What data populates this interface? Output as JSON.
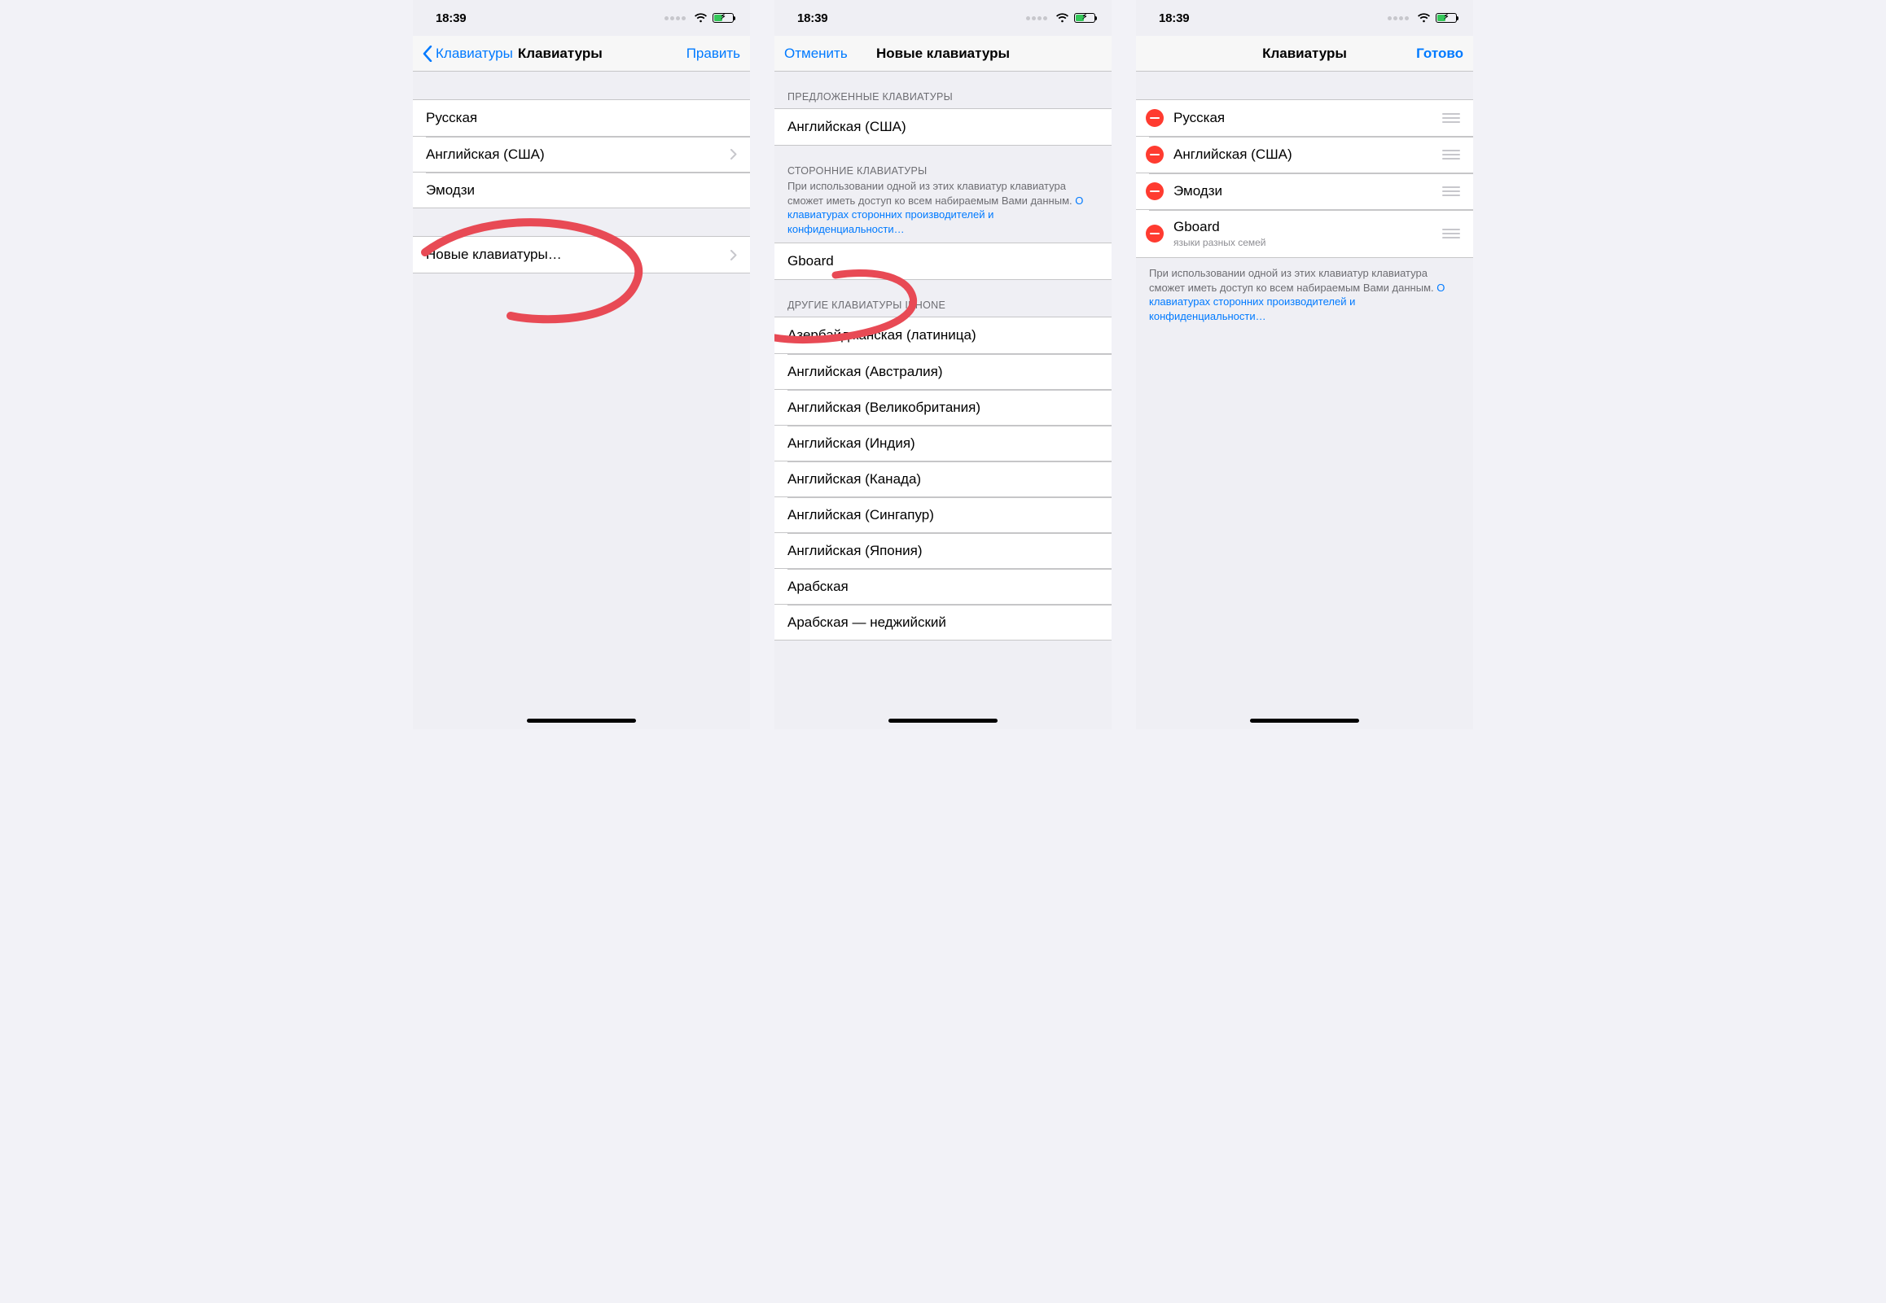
{
  "status": {
    "time": "18:39"
  },
  "phone1": {
    "nav": {
      "back": "Клавиатуры",
      "title": "Клавиатуры",
      "right": "Править"
    },
    "rows": [
      "Русская",
      "Английская (США)",
      "Эмодзи"
    ],
    "addRow": "Новые клавиатуры…"
  },
  "phone2": {
    "nav": {
      "left": "Отменить",
      "title": "Новые клавиатуры"
    },
    "suggestedHeader": "ПРЕДЛОЖЕННЫЕ КЛАВИАТУРЫ",
    "suggested": [
      "Английская (США)"
    ],
    "thirdHeader": "СТОРОННИЕ КЛАВИАТУРЫ",
    "thirdFooter": "При использовании одной из этих клавиатур клавиатура сможет иметь доступ ко всем набираемым Вами данным. ",
    "thirdFooterLink": "О клавиатурах сторонних производителей и конфиденциальности…",
    "third": [
      "Gboard"
    ],
    "otherHeader": "ДРУГИЕ КЛАВИАТУРЫ IPHONE",
    "other": [
      "Азербайджанская (латиница)",
      "Английская (Австралия)",
      "Английская (Великобритания)",
      "Английская (Индия)",
      "Английская (Канада)",
      "Английская (Сингапур)",
      "Английская (Япония)",
      "Арабская",
      "Арабская — неджийский"
    ]
  },
  "phone3": {
    "nav": {
      "title": "Клавиатуры",
      "right": "Готово"
    },
    "rows": [
      {
        "label": "Русская"
      },
      {
        "label": "Английская (США)"
      },
      {
        "label": "Эмодзи"
      },
      {
        "label": "Gboard",
        "sub": "языки разных семей"
      }
    ],
    "footer": "При использовании одной из этих клавиатур клавиатура сможет иметь доступ ко всем набираемым Вами данным. ",
    "footerLink": "О клавиатурах сторонних производителей и конфиденциальности…"
  }
}
